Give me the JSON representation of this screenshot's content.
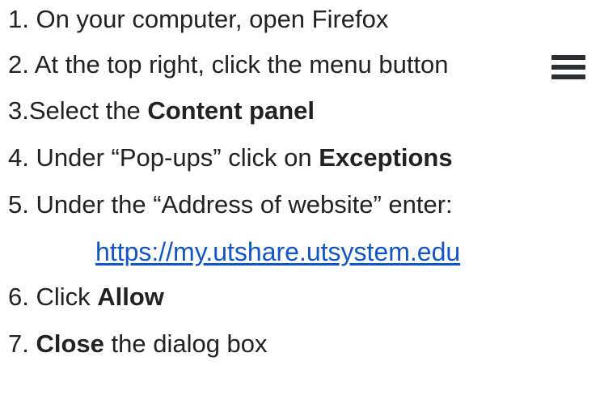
{
  "steps": {
    "step1": {
      "text": "1. On your computer, open Firefox"
    },
    "step2": {
      "text": "2. At the top right, click the menu button",
      "icon": "hamburger-menu-icon"
    },
    "step3": {
      "prefix": "3.Select the ",
      "bold": "Content panel"
    },
    "step4": {
      "prefix": "4. Under “Pop-ups” click on ",
      "bold": "Exceptions"
    },
    "step5": {
      "text": "5. Under the “Address of website” enter:"
    },
    "link": {
      "text": "https://my.utshare.utsystem.edu",
      "href": "https://my.utshare.utsystem.edu"
    },
    "step6": {
      "prefix": "6. Click ",
      "bold": "Allow"
    },
    "step7": {
      "prefix": "7. ",
      "bold": "Close",
      "suffix": " the dialog box"
    }
  },
  "colors": {
    "text": "#222222",
    "link": "#1155cc",
    "icon": "#2a2e33"
  }
}
